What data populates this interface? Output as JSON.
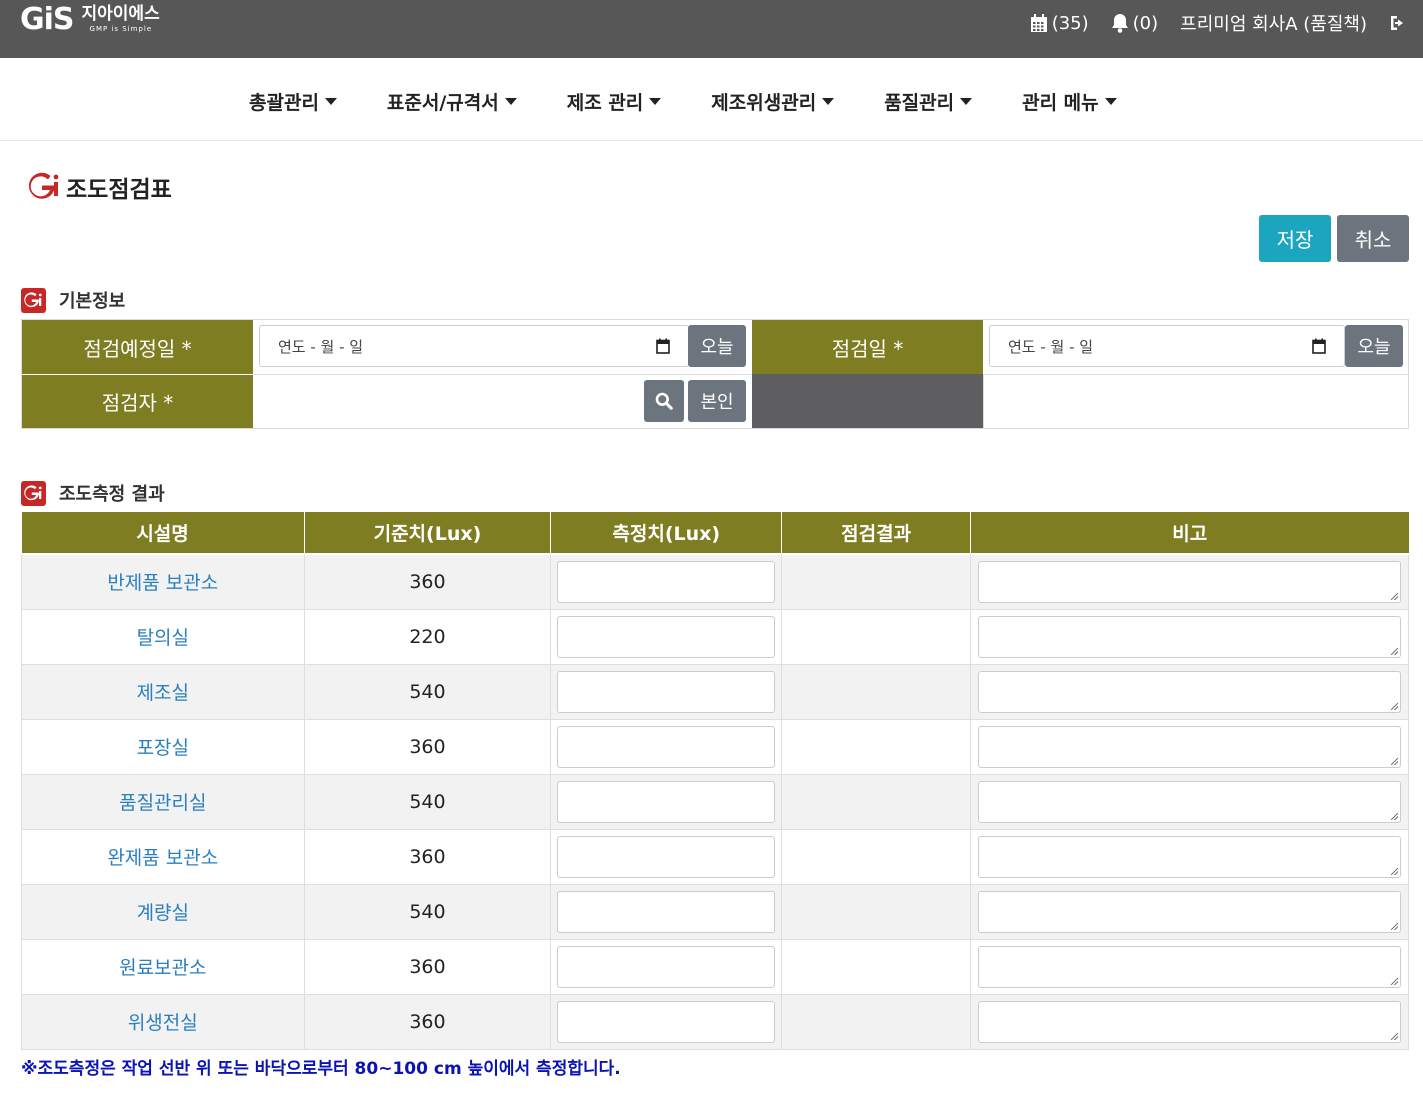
{
  "header": {
    "logo_mark": "GiS",
    "logo_name": "지아이에스",
    "logo_slogan": "GMP is Simple",
    "calendar_count": "(35)",
    "notification_count": "(0)",
    "user": "프리미엄 회사A (품질책)"
  },
  "nav": {
    "items": [
      "총괄관리",
      "표준서/규격서",
      "제조 관리",
      "제조위생관리",
      "품질관리",
      "관리 메뉴"
    ]
  },
  "page": {
    "title": "조도점검표",
    "save_label": "저장",
    "cancel_label": "취소"
  },
  "basic_info": {
    "section_title": "기본정보",
    "planned_date_label": "점검예정일 *",
    "planned_date_placeholder": "연도 - 월 - 일",
    "today_label": "오늘",
    "inspect_date_label": "점검일 *",
    "inspect_date_placeholder": "연도 - 월 - 일",
    "inspector_label": "점검자 *",
    "inspector_value": "",
    "self_label": "본인"
  },
  "results": {
    "section_title": "조도측정 결과",
    "columns": [
      "시설명",
      "기준치(Lux)",
      "측정치(Lux)",
      "점검결과",
      "비고"
    ],
    "rows": [
      {
        "facility": "반제품 보관소",
        "standard": "360",
        "measured": "",
        "result": "",
        "remark": ""
      },
      {
        "facility": "탈의실",
        "standard": "220",
        "measured": "",
        "result": "",
        "remark": ""
      },
      {
        "facility": "제조실",
        "standard": "540",
        "measured": "",
        "result": "",
        "remark": ""
      },
      {
        "facility": "포장실",
        "standard": "360",
        "measured": "",
        "result": "",
        "remark": ""
      },
      {
        "facility": "품질관리실",
        "standard": "540",
        "measured": "",
        "result": "",
        "remark": ""
      },
      {
        "facility": "완제품 보관소",
        "standard": "360",
        "measured": "",
        "result": "",
        "remark": ""
      },
      {
        "facility": "계량실",
        "standard": "540",
        "measured": "",
        "result": "",
        "remark": ""
      },
      {
        "facility": "원료보관소",
        "standard": "360",
        "measured": "",
        "result": "",
        "remark": ""
      },
      {
        "facility": "위생전실",
        "standard": "360",
        "measured": "",
        "result": "",
        "remark": ""
      }
    ],
    "note": "※조도측정은 작업 선반 위 또는 바닥으로부터 80~100 cm 높이에서 측정합니다."
  },
  "colors": {
    "header_bg": "#575757",
    "label_bg": "#7f7d22",
    "save_button": "#1ba5bf",
    "secondary_button": "#6c757d",
    "brand_red": "#c62828",
    "link_blue": "#2a7fbf",
    "note_blue": "#0a14b4"
  }
}
